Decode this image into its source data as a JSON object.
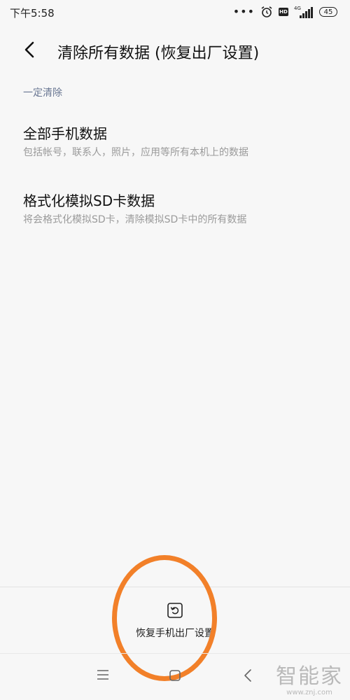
{
  "status_bar": {
    "time": "下午5:58",
    "dots": "•••",
    "hd": "HD",
    "network": "4G",
    "battery": "45"
  },
  "header": {
    "title": "清除所有数据 (恢复出厂设置)"
  },
  "section": {
    "label": "一定清除"
  },
  "options": [
    {
      "title": "全部手机数据",
      "description": "包括帐号，联系人，照片，应用等所有本机上的数据"
    },
    {
      "title": "格式化模拟SD卡数据",
      "description": "将会格式化模拟SD卡，清除模拟SD卡中的所有数据"
    }
  ],
  "bottom_action": {
    "label": "恢复手机出厂设置"
  },
  "watermark": {
    "logo": "智能家",
    "url": "www.znj.com"
  },
  "colors": {
    "background": "#f7f7f7",
    "section_label": "#6a7793",
    "highlight": "#f28029",
    "secondary_text": "#9a9a9a"
  }
}
